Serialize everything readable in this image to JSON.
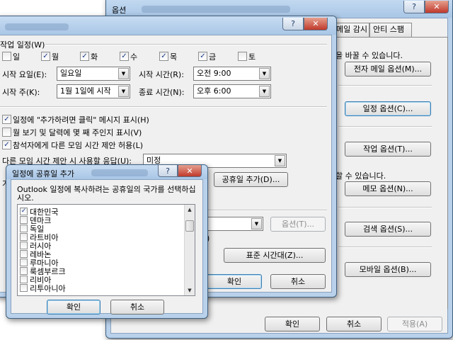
{
  "options_window": {
    "title": "옵션",
    "tabs": [
      "메일 감시",
      "안티 스팸"
    ],
    "texts": {
      "change_hint": "을 바꿀 수 있습니다.",
      "can_hint": "할 수 있습니다."
    },
    "buttons": {
      "email_options": "전자 메일 옵션(M)...",
      "calendar_options": "일정 옵션(C)...",
      "task_options": "작업 옵션(T)...",
      "notes_options": "메모 옵션(N)...",
      "search_options": "검색 옵션(S)...",
      "mobile_options": "모바일 옵션(B)...",
      "ok": "확인",
      "cancel": "취소",
      "apply": "적용(A)"
    }
  },
  "calendar_window": {
    "work_week_label": "작업 일정(W)",
    "days": [
      {
        "label": "일",
        "checked": false
      },
      {
        "label": "월",
        "checked": true
      },
      {
        "label": "화",
        "checked": true
      },
      {
        "label": "수",
        "checked": true
      },
      {
        "label": "목",
        "checked": true
      },
      {
        "label": "금",
        "checked": true
      },
      {
        "label": "토",
        "checked": false
      }
    ],
    "first_day_label": "시작 요일(E):",
    "first_day_value": "일요일",
    "start_time_label": "시작 시간(R):",
    "start_time_value": "오전 9:00",
    "first_week_label": "시작 주(K):",
    "first_week_value": "1월 1일에 시작",
    "end_time_label": "종료 시간(N):",
    "end_time_value": "오후 6:00",
    "opt_click_to_add": "일정에 \"추가하려면 클릭\" 메시지 표시(H)",
    "opt_week_numbers": "월 보기 및 달력에 몇 째 주인지 표시(V)",
    "opt_propose_times": "참석자에게 다른 모임 시간 제안 허용(L)",
    "response_label": "다른 모임 시간 제안 시 사용할 응답(U):",
    "response_value": "미정",
    "add_holidays_button": "공휴일 추가(D)...",
    "time_zones_button": "표준 시간대(Z)...",
    "options_button": "옵션(T)...",
    "ok": "확인",
    "cancel": "취소",
    "frag_ga": "가",
    "frag_paren": ")"
  },
  "holidays_dialog": {
    "title": "일정에 공휴일 추가",
    "instruction": "Outlook 일정에 복사하려는 공휴일의 국가를 선택하십시오.",
    "countries": [
      {
        "name": "대한민국",
        "checked": true
      },
      {
        "name": "덴마크",
        "checked": false
      },
      {
        "name": "독일",
        "checked": false
      },
      {
        "name": "라트비아",
        "checked": false
      },
      {
        "name": "러시아",
        "checked": false
      },
      {
        "name": "레바논",
        "checked": false
      },
      {
        "name": "루마니아",
        "checked": false
      },
      {
        "name": "룩셈부르크",
        "checked": false
      },
      {
        "name": "리비아",
        "checked": false
      },
      {
        "name": "리투아니아",
        "checked": false
      }
    ],
    "ok": "확인",
    "cancel": "취소"
  },
  "icons": {
    "help": "help-icon",
    "close": "close-icon",
    "dropdown": "chevron-down-icon",
    "check": "check-icon"
  },
  "colors": {
    "frame": "#b9d1ea",
    "close_button": "#c0392b",
    "check": "#1c3c8c",
    "default_button_border": "#3c7fb1"
  }
}
